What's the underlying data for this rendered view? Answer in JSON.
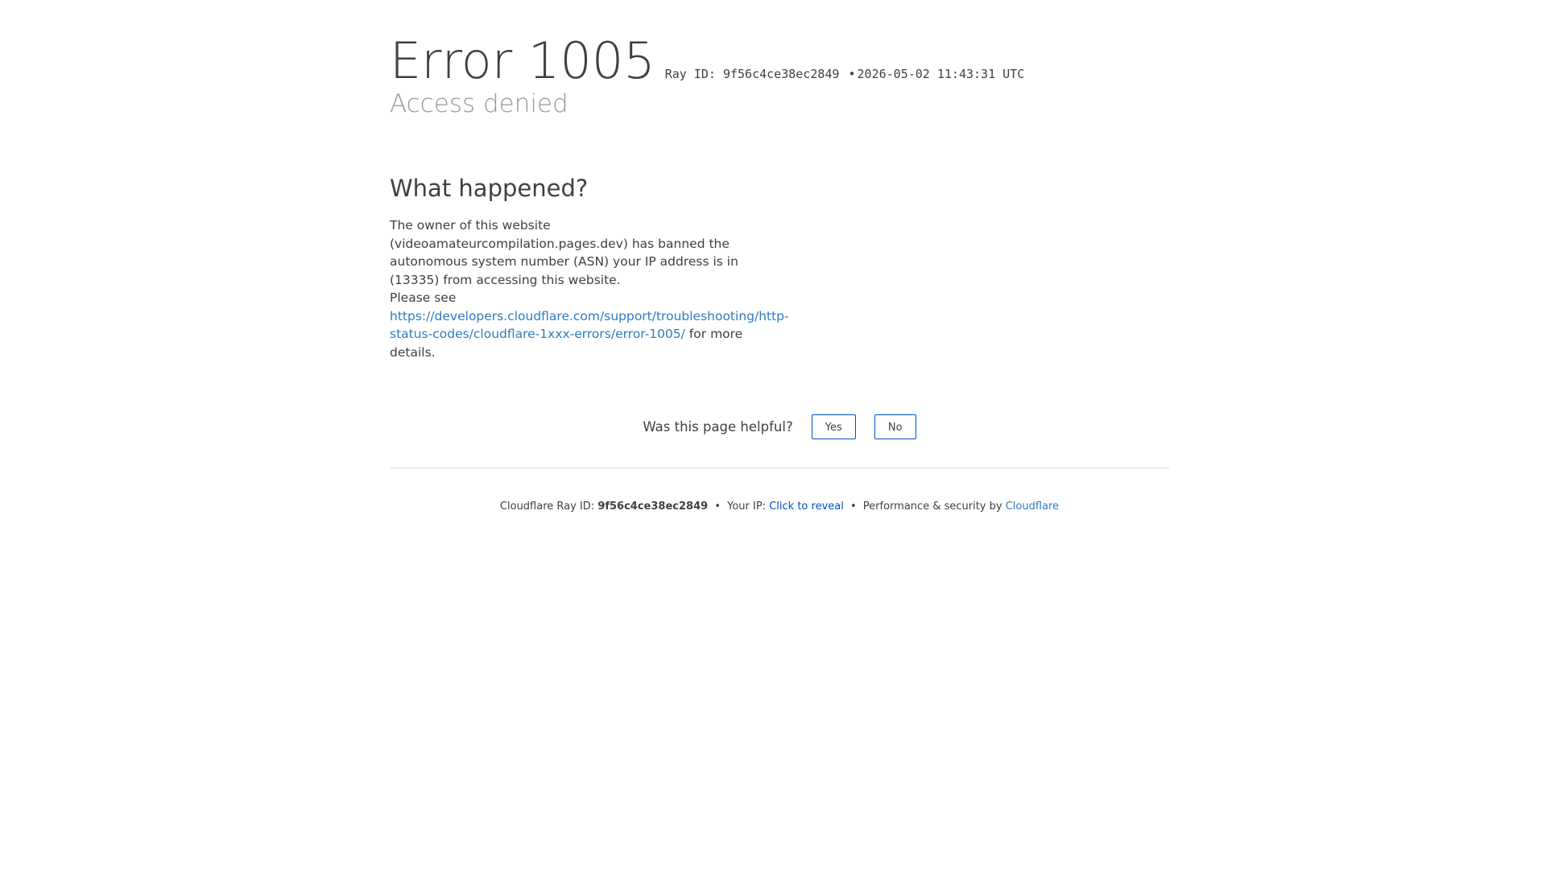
{
  "header": {
    "title": "Error 1005",
    "ray_label": "Ray ID: 9f56c4ce38ec2849",
    "separator": "•",
    "timestamp": "2026-05-02 11:43:31 UTC",
    "subtitle": "Access denied"
  },
  "main": {
    "section_title": "What happened?",
    "paragraph1": "The owner of this website (videoamateurcompilation.pages.dev) has banned the autonomous system number (ASN) your IP address is in (13335) from accessing this website.",
    "please_see": "Please see",
    "link_text": "https://developers.cloudflare.com/support/troubleshooting/http-status-codes/cloudflare-1xxx-errors/error-1005/",
    "after_link": "for more details."
  },
  "feedback": {
    "question": "Was this page helpful?",
    "yes_label": "Yes",
    "no_label": "No"
  },
  "footer": {
    "ray_prefix": "Cloudflare Ray ID:",
    "ray_id": "9f56c4ce38ec2849",
    "separator": "•",
    "ip_prefix": "Your IP:",
    "ip_reveal": "Click to reveal",
    "perf_prefix": "Performance & security by",
    "cf_link": "Cloudflare"
  },
  "colors": {
    "link": "#2f7bbf",
    "button_border": "#0051c3",
    "subtitle": "#999999",
    "text": "#404040"
  }
}
